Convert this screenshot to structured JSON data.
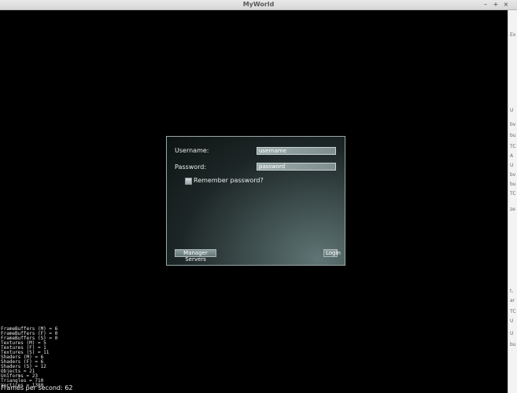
{
  "window": {
    "title": "MyWorld",
    "controls": {
      "minimize": "–",
      "maximize": "+",
      "close": "×"
    }
  },
  "side_strip": {
    "fragments": [
      "Ex",
      "U",
      "bv",
      "bu",
      "TC",
      "A",
      "U",
      "bv",
      "bu",
      "TC",
      "ze",
      "t,",
      "ar",
      "TC",
      "U",
      "U",
      "bu"
    ]
  },
  "login_dialog": {
    "username_label": "Username:",
    "username_value": "username",
    "password_label": "Password:",
    "password_value": "password",
    "remember_label": "Remember password?",
    "remember_checked": false,
    "manager_servers_button": "Manager Servers",
    "login_button": "Login"
  },
  "stats": {
    "lines": [
      "FrameBuffers (M) = 6",
      "FrameBuffers (F) = 0",
      "FrameBuffers (S) = 0",
      "Textures (M) = 5",
      "Textures (F) = 1",
      "Textures (S) = 11",
      "Shaders (M) = 6",
      "Shaders (F) = 6",
      "Shaders (S) = 12",
      "Objects = 21",
      "Uniforms = 23",
      "Triangles = 710",
      "Vertices = 1380"
    ],
    "fps_text": "Frames per second: 62"
  }
}
